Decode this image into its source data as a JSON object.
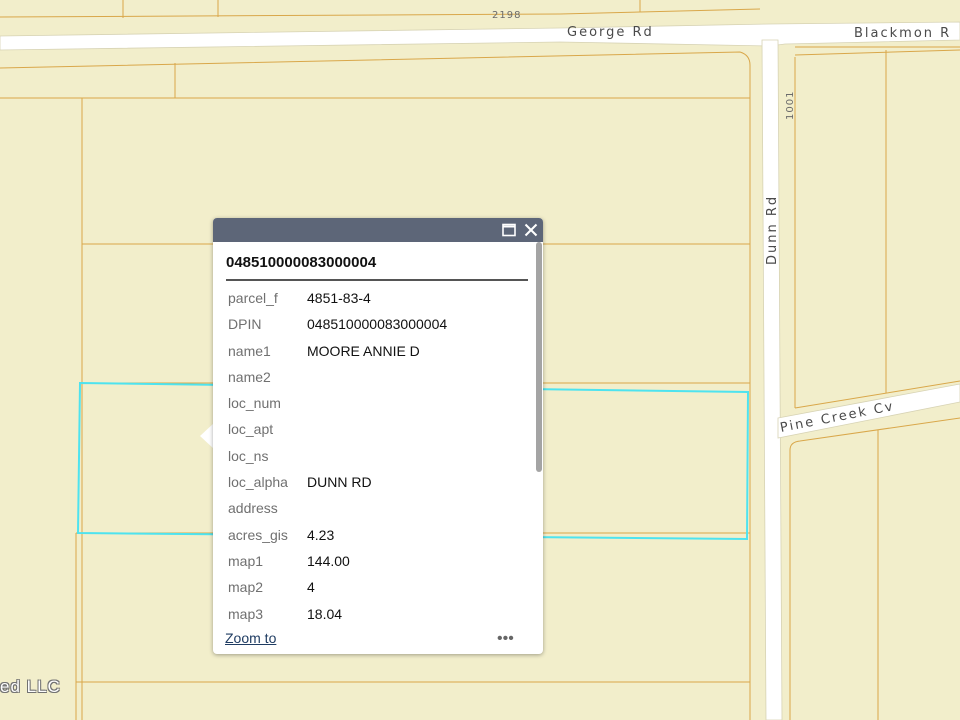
{
  "map": {
    "roads": {
      "george_rd": "George Rd",
      "blackmon_rd": "Blackmon R",
      "dunn_rd": "Dunn Rd",
      "pine_creek_cv": "Pine Creek Cv"
    },
    "address_numbers": {
      "top": "2198",
      "right": "1001"
    },
    "attribution": "ed LLC",
    "colors": {
      "background": "#f2eecb",
      "parcel_line": "#d9a74a",
      "road": "#ffffff",
      "selection": "#4ee3ef"
    }
  },
  "popup": {
    "title": "048510000083000004",
    "header_color": "#5d6678",
    "maximize_icon": "maximize-icon",
    "close_icon": "close-icon",
    "attributes": [
      {
        "key": "parcel_f",
        "value": "4851-83-4"
      },
      {
        "key": "DPIN",
        "value": "048510000083000004"
      },
      {
        "key": "name1",
        "value": "MOORE ANNIE D"
      },
      {
        "key": "name2",
        "value": ""
      },
      {
        "key": "loc_num",
        "value": ""
      },
      {
        "key": "loc_apt",
        "value": ""
      },
      {
        "key": "loc_ns",
        "value": ""
      },
      {
        "key": "loc_alpha",
        "value": "DUNN RD"
      },
      {
        "key": "address",
        "value": ""
      },
      {
        "key": "acres_gis",
        "value": "4.23"
      },
      {
        "key": "map1",
        "value": "144.00"
      },
      {
        "key": "map2",
        "value": "4"
      },
      {
        "key": "map3",
        "value": "18.04"
      }
    ],
    "footer": {
      "zoom_label": "Zoom to",
      "more_label": "•••"
    }
  }
}
